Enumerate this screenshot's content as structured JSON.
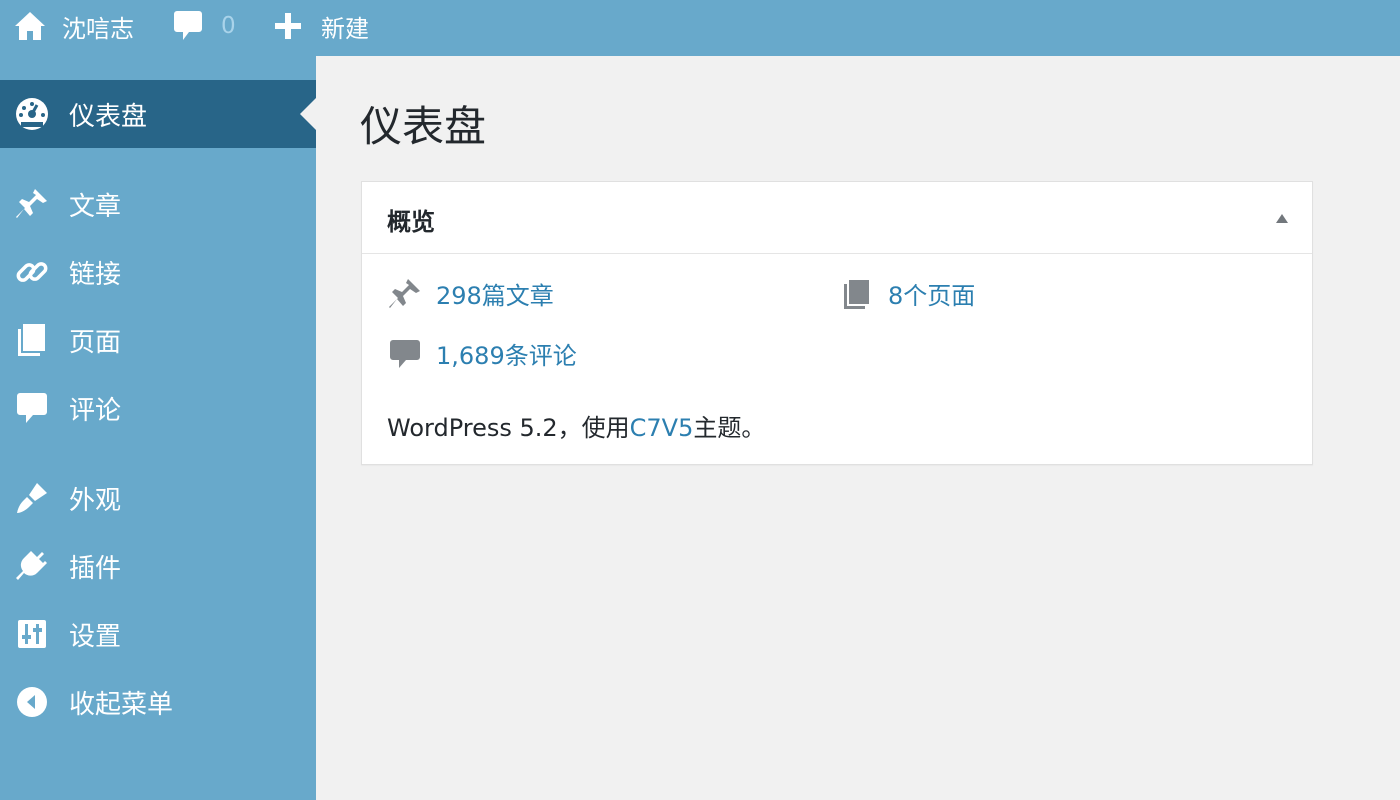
{
  "adminbar": {
    "site_name": "沈唁志",
    "comments_count": "0",
    "new_label": "新建"
  },
  "sidebar": {
    "items": [
      {
        "label": "仪表盘",
        "icon": "dashboard-icon",
        "current": true
      },
      {
        "label": "文章",
        "icon": "pushpin-icon"
      },
      {
        "label": "链接",
        "icon": "link-icon"
      },
      {
        "label": "页面",
        "icon": "pages-icon"
      },
      {
        "label": "评论",
        "icon": "comment-icon"
      },
      {
        "label": "外观",
        "icon": "paintbrush-icon"
      },
      {
        "label": "插件",
        "icon": "plugin-icon"
      },
      {
        "label": "设置",
        "icon": "settings-icon"
      },
      {
        "label": "收起菜单",
        "icon": "collapse-icon"
      }
    ]
  },
  "main": {
    "page_title": "仪表盘",
    "overview": {
      "title": "概览",
      "posts": "298篇文章",
      "pages": "8个页面",
      "comments": "1,689条评论",
      "version_prefix": "WordPress 5.2，使用",
      "theme": "C7V5",
      "version_suffix": "主题。"
    }
  },
  "colors": {
    "adminbar_bg": "#68a9cb",
    "sidebar_bg": "#68a9cb",
    "sidebar_current_bg": "#286588",
    "link": "#2c7fb0",
    "page_bg": "#f1f1f1"
  }
}
